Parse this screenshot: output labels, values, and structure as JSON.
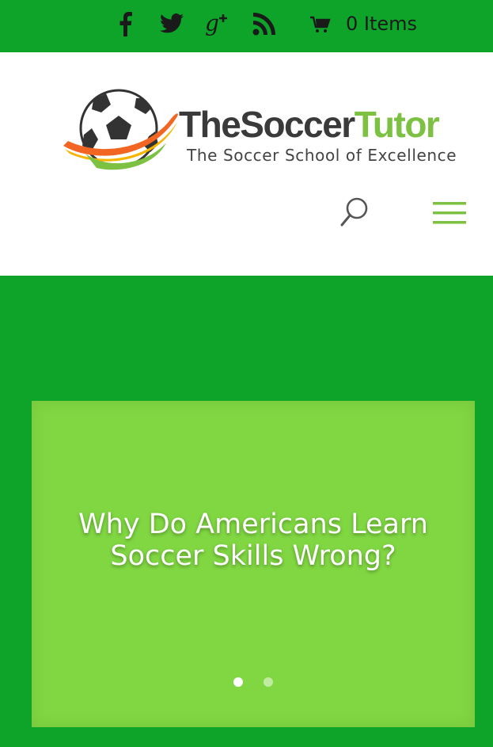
{
  "topbar": {
    "social_icons": [
      "facebook-icon",
      "twitter-icon",
      "google-plus-icon",
      "rss-icon"
    ],
    "cart_icon": "cart-icon",
    "cart_label": "0 Items"
  },
  "header": {
    "logo": {
      "name_part1": "TheSoccer",
      "name_part2": "Tutor",
      "tagline": "The Soccer School of Excellence"
    },
    "search_icon": "search-icon",
    "menu_icon": "hamburger-menu-icon"
  },
  "hero": {
    "slide_title": "Why Do Americans Learn Soccer Skills Wrong?",
    "slide_count": 2,
    "active_slide": 1
  },
  "colors": {
    "topbar_bg": "#0ea42a",
    "slide_bg": "#80d742",
    "brand_dark": "#3a3a3a",
    "brand_green": "#7cc142",
    "menu_icon": "#7cc142"
  }
}
